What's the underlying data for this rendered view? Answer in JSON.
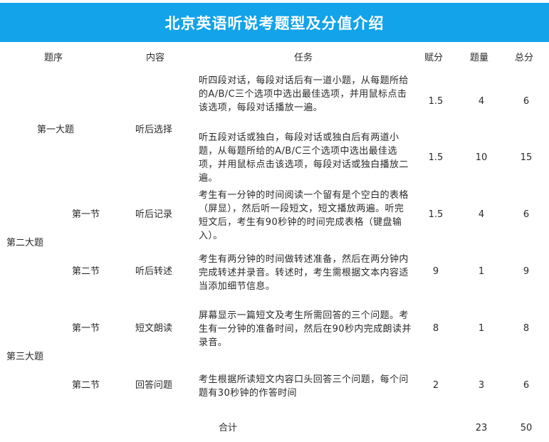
{
  "title": "北京英语听说考题型及分值介绍",
  "headers": {
    "order": "题序",
    "content": "内容",
    "task": "任务",
    "score_each": "赋分",
    "count": "题量",
    "total": "总分"
  },
  "sections": {
    "one": "第一大题",
    "two": "第二大题",
    "three": "第三大题",
    "part1": "第一节",
    "part2": "第二节"
  },
  "rows": [
    {
      "content": "听后选择",
      "task": "听四段对话，每段对话后有一道小题，从每题所给的A/B/C三个选项中选出最佳选项，并用鼠标点击该选项，每段对话播放一遍。",
      "score_each": "1.5",
      "count": "4",
      "total": "6"
    },
    {
      "content": "",
      "task": "听五段对话或独白，每段对话或独白后有两道小题，从每题所给的A/B/C三个选项中选出最佳选项，并用鼠标点击该选项，每段对话或独白播放二遍。",
      "score_each": "1.5",
      "count": "10",
      "total": "15"
    },
    {
      "content": "听后记录",
      "task": "考生有一分钟的时间阅读一个留有是个空白的表格（屏显），然后听一段短文，短文播放两遍。听完短文后，考生有90秒钟的时间完成表格（键盘输入）。",
      "score_each": "1.5",
      "count": "4",
      "total": "6"
    },
    {
      "content": "听后转述",
      "task": "考生有两分钟的时间做转述准备，然后在两分钟内完成转述并录音。转述时，考生需根据文本内容适当添加细节信息。",
      "score_each": "9",
      "count": "1",
      "total": "9"
    },
    {
      "content": "短文朗读",
      "task": "屏幕显示一篇短文及考生所需回答的三个问题。考生有一分钟的准备时间，然后在90秒内完成朗读并录音。",
      "score_each": "8",
      "count": "1",
      "total": "8"
    },
    {
      "content": "回答问题",
      "task": "考生根据所读短文内容口头回答三个问题，每个问题有30秒钟的作答时间",
      "score_each": "2",
      "count": "3",
      "total": "6"
    }
  ],
  "summary": {
    "label": "合计",
    "count": "23",
    "total": "50"
  }
}
